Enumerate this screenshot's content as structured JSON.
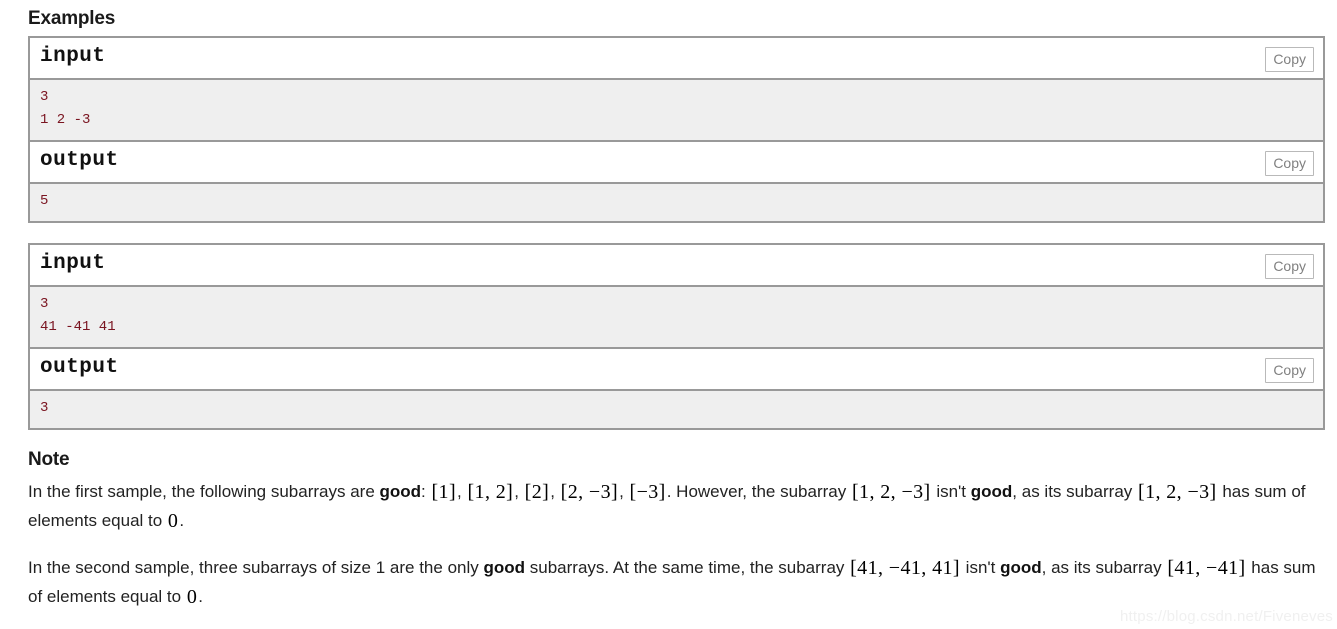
{
  "examples": {
    "heading": "Examples",
    "copy_label": "Copy",
    "samples": [
      {
        "input_label": "input",
        "input_data": "3\n1 2 -3",
        "output_label": "output",
        "output_data": "5"
      },
      {
        "input_label": "input",
        "input_data": "3\n41 -41 41",
        "output_label": "output",
        "output_data": "3"
      }
    ]
  },
  "note": {
    "heading": "Note",
    "paragraphs": [
      {
        "parts": [
          {
            "t": "text",
            "v": "In the first sample, the following subarrays are "
          },
          {
            "t": "bold",
            "v": "good"
          },
          {
            "t": "text",
            "v": ": "
          },
          {
            "t": "math",
            "v": "[1]"
          },
          {
            "t": "text",
            "v": ", "
          },
          {
            "t": "math",
            "v": "[1, 2]"
          },
          {
            "t": "text",
            "v": ", "
          },
          {
            "t": "math",
            "v": "[2]"
          },
          {
            "t": "text",
            "v": ", "
          },
          {
            "t": "math",
            "v": "[2, −3]"
          },
          {
            "t": "text",
            "v": ", "
          },
          {
            "t": "math",
            "v": "[−3]"
          },
          {
            "t": "text",
            "v": ". However, the subarray "
          },
          {
            "t": "math",
            "v": "[1, 2, −3]"
          },
          {
            "t": "text",
            "v": " isn't "
          },
          {
            "t": "bold",
            "v": "good"
          },
          {
            "t": "text",
            "v": ", as its subarray "
          },
          {
            "t": "math",
            "v": "[1, 2, −3]"
          },
          {
            "t": "text",
            "v": " has sum of elements equal to "
          },
          {
            "t": "math",
            "v": "0"
          },
          {
            "t": "text",
            "v": "."
          }
        ]
      },
      {
        "parts": [
          {
            "t": "text",
            "v": "In the second sample, three subarrays of size 1 are the only "
          },
          {
            "t": "bold",
            "v": "good"
          },
          {
            "t": "text",
            "v": " subarrays. At the same time, the subarray "
          },
          {
            "t": "math",
            "v": "[41, −41, 41]"
          },
          {
            "t": "text",
            "v": " isn't "
          },
          {
            "t": "bold",
            "v": "good"
          },
          {
            "t": "text",
            "v": ", as its subarray "
          },
          {
            "t": "math",
            "v": "[41, −41]"
          },
          {
            "t": "text",
            "v": " has sum of elements equal to "
          },
          {
            "t": "math",
            "v": "0"
          },
          {
            "t": "text",
            "v": "."
          }
        ]
      }
    ]
  },
  "watermark": {
    "text": "https://blog.csdn.net/Fiveneves"
  },
  "colors": {
    "sample_border": "#999999",
    "sample_data_bg": "#efefef",
    "sample_data_text": "#7a1420",
    "copy_text": "#808080",
    "watermark": "#f0f0f0"
  }
}
